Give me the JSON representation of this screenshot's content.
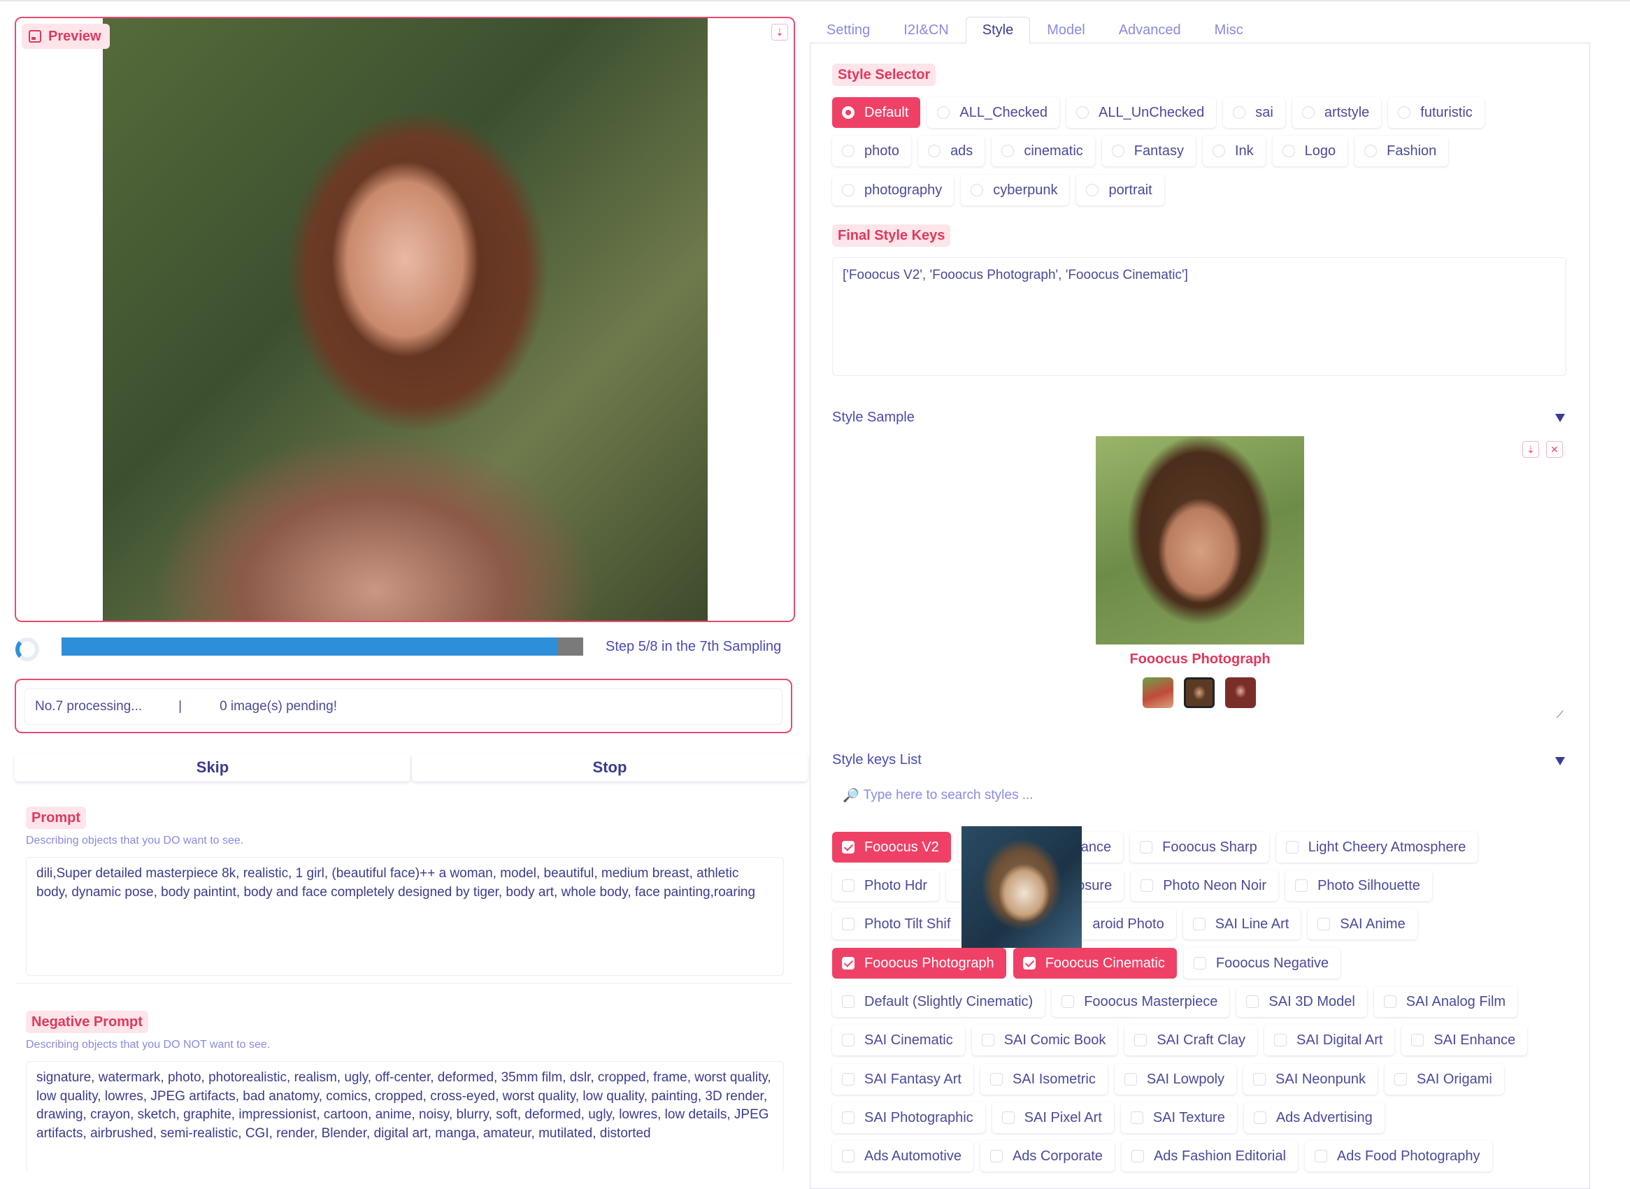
{
  "preview": {
    "label": "Preview"
  },
  "progress": {
    "fraction": 0.95,
    "text": "Step 5/8 in the 7th Sampling"
  },
  "status": {
    "processing": "No.7 processing...",
    "separator": "|",
    "pending": "0  image(s) pending!"
  },
  "actions": {
    "skip": "Skip",
    "stop": "Stop"
  },
  "prompt": {
    "label": "Prompt",
    "hint": "Describing objects that you DO want to see.",
    "value": "dili,Super detailed masterpiece 8k, realistic, 1 girl, (beautiful face)++ a woman, model, beautiful, medium breast, athletic body, dynamic pose, body paintint, body and face completely designed by tiger, body art, whole body, face painting,roaring"
  },
  "negative_prompt": {
    "label": "Negative Prompt",
    "hint": "Describing objects that you DO NOT want to see.",
    "value": "signature, watermark, photo, photorealistic, realism, ugly, off-center, deformed, 35mm film, dslr, cropped, frame, worst quality, low quality, lowres, JPEG artifacts, bad anatomy, comics, cropped, cross-eyed, worst quality, low quality, painting, 3D render, drawing, crayon, sketch, graphite, impressionist, cartoon, anime, noisy, blurry, soft, deformed, ugly, lowres, low details, JPEG artifacts, airbrushed, semi-realistic, CGI, render, Blender, digital art, manga, amateur, mutilated, distorted"
  },
  "tabs": [
    "Setting",
    "I2I&CN",
    "Style",
    "Model",
    "Advanced",
    "Misc"
  ],
  "active_tab": "Style",
  "style_selector": {
    "label": "Style Selector",
    "rows": [
      [
        {
          "label": "Default",
          "selected": true
        },
        {
          "label": "ALL_Checked"
        },
        {
          "label": "ALL_UnChecked"
        },
        {
          "label": "sai"
        },
        {
          "label": "artstyle"
        },
        {
          "label": "futuristic"
        }
      ],
      [
        {
          "label": "photo"
        },
        {
          "label": "ads"
        },
        {
          "label": "cinematic"
        },
        {
          "label": "Fantasy"
        },
        {
          "label": "Ink"
        },
        {
          "label": "Logo"
        },
        {
          "label": "Fashion"
        }
      ],
      [
        {
          "label": "photography"
        },
        {
          "label": "cyberpunk"
        },
        {
          "label": "portrait"
        }
      ]
    ]
  },
  "final_style_keys": {
    "label": "Final Style Keys",
    "value": "['Fooocus V2', 'Fooocus Photograph', 'Fooocus Cinematic']"
  },
  "style_sample": {
    "title": "Style Sample",
    "caption": "Fooocus Photograph",
    "download_icon": "⇣",
    "close_icon": "✕",
    "resize_icon": "⟋"
  },
  "style_keys_list": {
    "title": "Style keys List",
    "search_icon": "🔎",
    "search_placeholder": "Type here to search styles ...",
    "rows": [
      [
        {
          "label": "Fooocus V2",
          "checked": true
        },
        {
          "label": "ance",
          "hidden_prefix": true
        },
        {
          "label": "Fooocus Sharp"
        },
        {
          "label": "Light Cheery Atmosphere"
        }
      ],
      [
        {
          "label": "Photo Hdr"
        },
        {
          "label": "posure",
          "hidden_prefix": true
        },
        {
          "label": "Photo Neon Noir"
        },
        {
          "label": "Photo Silhouette"
        }
      ],
      [
        {
          "label": "Photo Tilt Shif"
        },
        {
          "label": "aroid Photo",
          "hidden_prefix": true
        },
        {
          "label": "SAI Line Art"
        },
        {
          "label": "SAI Anime"
        }
      ],
      [
        {
          "label": "Fooocus Photograph",
          "checked": true
        },
        {
          "label": "Fooocus Cinematic",
          "checked": true
        },
        {
          "label": "Fooocus Negative"
        }
      ],
      [
        {
          "label": "Default (Slightly Cinematic)"
        },
        {
          "label": "Fooocus Masterpiece"
        },
        {
          "label": "SAI 3D Model"
        },
        {
          "label": "SAI Analog Film"
        }
      ],
      [
        {
          "label": "SAI Cinematic"
        },
        {
          "label": "SAI Comic Book"
        },
        {
          "label": "SAI Craft Clay"
        },
        {
          "label": "SAI Digital Art"
        },
        {
          "label": "SAI Enhance"
        }
      ],
      [
        {
          "label": "SAI Fantasy Art"
        },
        {
          "label": "SAI Isometric"
        },
        {
          "label": "SAI Lowpoly"
        },
        {
          "label": "SAI Neonpunk"
        },
        {
          "label": "SAI Origami"
        }
      ],
      [
        {
          "label": "SAI Photographic"
        },
        {
          "label": "SAI Pixel Art"
        },
        {
          "label": "SAI Texture"
        },
        {
          "label": "Ads Advertising"
        }
      ],
      [
        {
          "label": "Ads Automotive"
        },
        {
          "label": "Ads Corporate"
        },
        {
          "label": "Ads Fashion Editorial"
        },
        {
          "label": "Ads Food Photography"
        }
      ]
    ]
  },
  "colors": {
    "accent": "#ef4166",
    "text": "#3b3b8f",
    "hint": "#8a8ae0",
    "progress": "#2d8fd9"
  }
}
